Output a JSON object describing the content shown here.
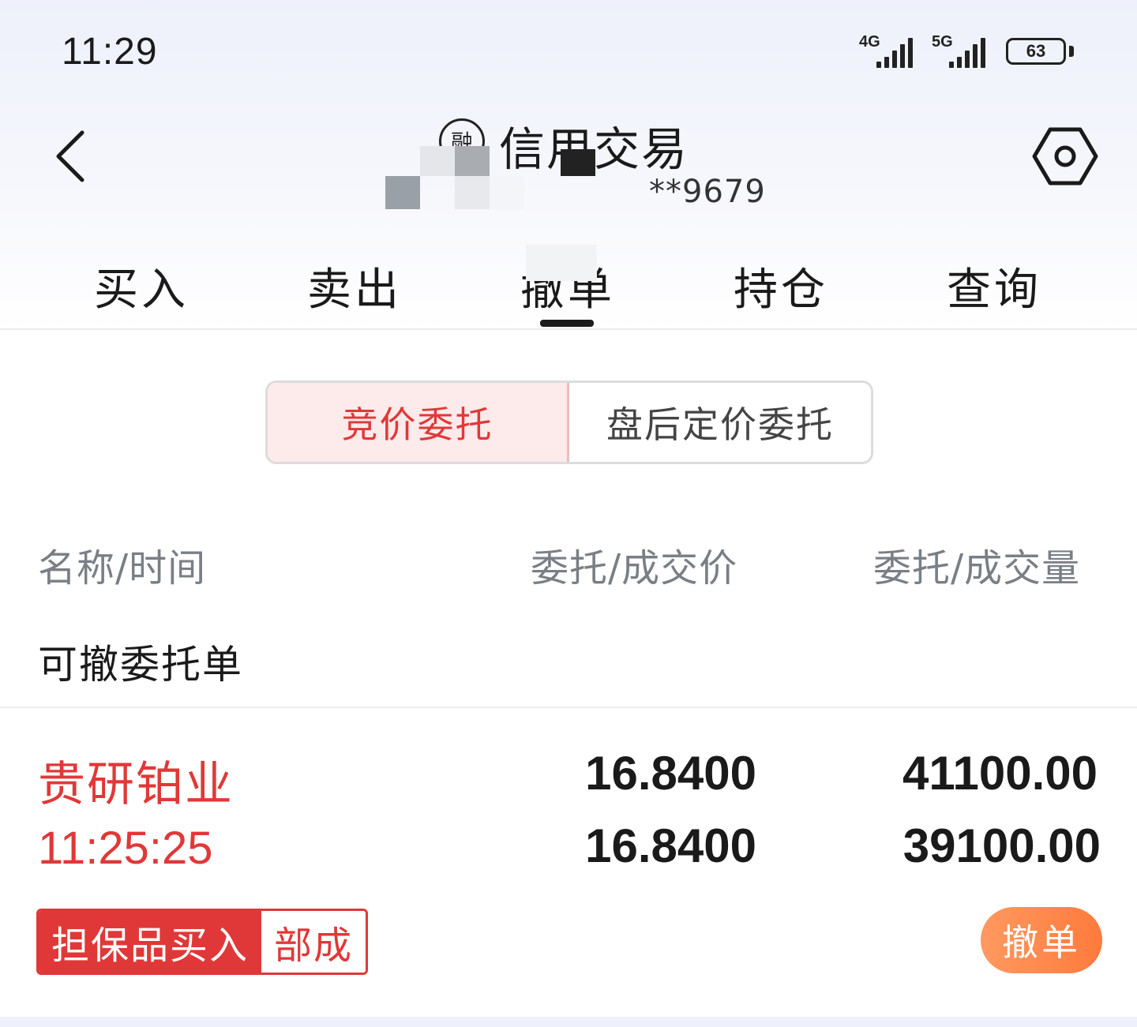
{
  "status_bar": {
    "time": "11:29",
    "network_1": "4G",
    "network_2": "5G",
    "battery": "63"
  },
  "header": {
    "badge": "融",
    "title": "信用交易",
    "account_masked": "**9679"
  },
  "tabs": [
    {
      "label": "买入"
    },
    {
      "label": "卖出"
    },
    {
      "label": "撤单",
      "active": true
    },
    {
      "label": "持仓"
    },
    {
      "label": "查询"
    }
  ],
  "segments": {
    "active": "竞价委托",
    "inactive": "盘后定价委托"
  },
  "columns": {
    "name_time": "名称/时间",
    "price": "委托/成交价",
    "volume": "委托/成交量"
  },
  "section_title": "可撤委托单",
  "order": {
    "name": "贵研铂业",
    "time": "11:25:25",
    "order_price": "16.8400",
    "deal_price": "16.8400",
    "order_volume": "41100.00",
    "deal_volume": "39100.00",
    "type_tag": "担保品买入",
    "status_tag": "部成",
    "cancel_label": "撤单"
  },
  "colors": {
    "accent_red": "#e03838",
    "cancel_orange": "#ff8a4c",
    "header_bg": "#eef1fb"
  }
}
